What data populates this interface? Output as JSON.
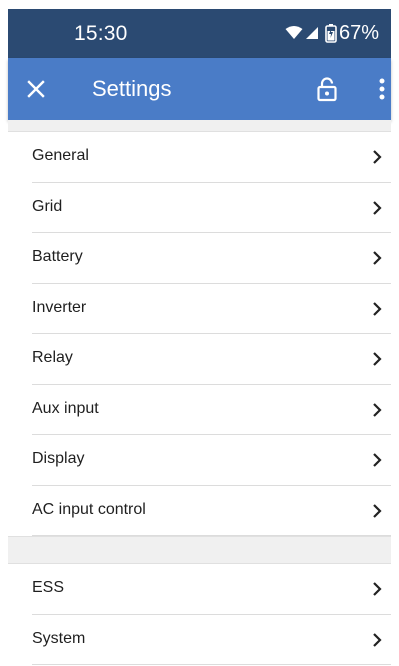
{
  "status_bar": {
    "time": "15:30",
    "battery_percent": "67%",
    "icons": [
      "wifi-icon",
      "cellular-signal-icon",
      "battery-charging-icon"
    ]
  },
  "app_bar": {
    "title": "Settings",
    "close_icon": "close-icon",
    "lock_icon": "unlocked-padlock-icon",
    "more_icon": "more-vertical-icon",
    "color": "#4a7cc7"
  },
  "settings": {
    "group1": [
      {
        "label": "General"
      },
      {
        "label": "Grid"
      },
      {
        "label": "Battery"
      },
      {
        "label": "Inverter"
      },
      {
        "label": "Relay"
      },
      {
        "label": "Aux input"
      },
      {
        "label": "Display"
      },
      {
        "label": "AC input control"
      }
    ],
    "group2": [
      {
        "label": "ESS"
      },
      {
        "label": "System"
      }
    ]
  },
  "colors": {
    "status_bar": "#2b4a72",
    "app_bar": "#4a7cc7",
    "section_gap": "#f0f0f0"
  }
}
